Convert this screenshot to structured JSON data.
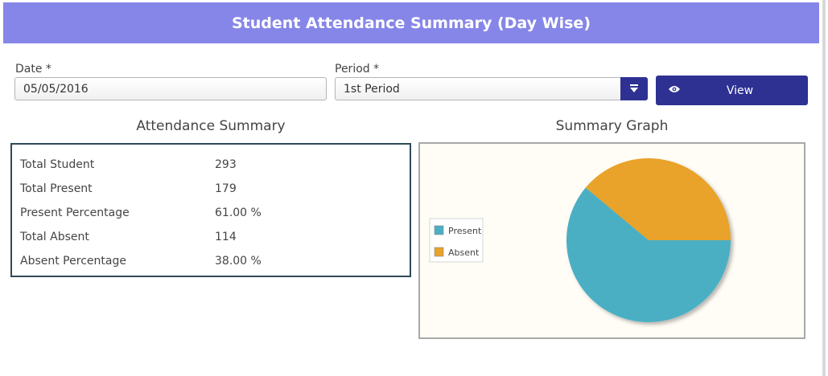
{
  "header": {
    "title": "Student Attendance Summary (Day Wise)"
  },
  "form": {
    "date_label": "Date *",
    "date_value": "05/05/2016",
    "period_label": "Period *",
    "period_value": "1st Period",
    "view_label": "View"
  },
  "summary": {
    "title": "Attendance Summary",
    "rows": [
      {
        "label": "Total Student",
        "value": "293"
      },
      {
        "label": "Total Present",
        "value": "179"
      },
      {
        "label": "Present Percentage",
        "value": "61.00 %"
      },
      {
        "label": "Total Absent",
        "value": "114"
      },
      {
        "label": "Absent Percentage",
        "value": "38.00 %"
      }
    ]
  },
  "graph": {
    "title": "Summary Graph"
  },
  "chart_data": {
    "type": "pie",
    "categories": [
      "Present",
      "Absent"
    ],
    "values": [
      179,
      114
    ],
    "colors": [
      "#4bafc4",
      "#e9a22a"
    ],
    "legend": "left"
  },
  "colors": {
    "header": "#8686e8",
    "button": "#2e3192"
  }
}
